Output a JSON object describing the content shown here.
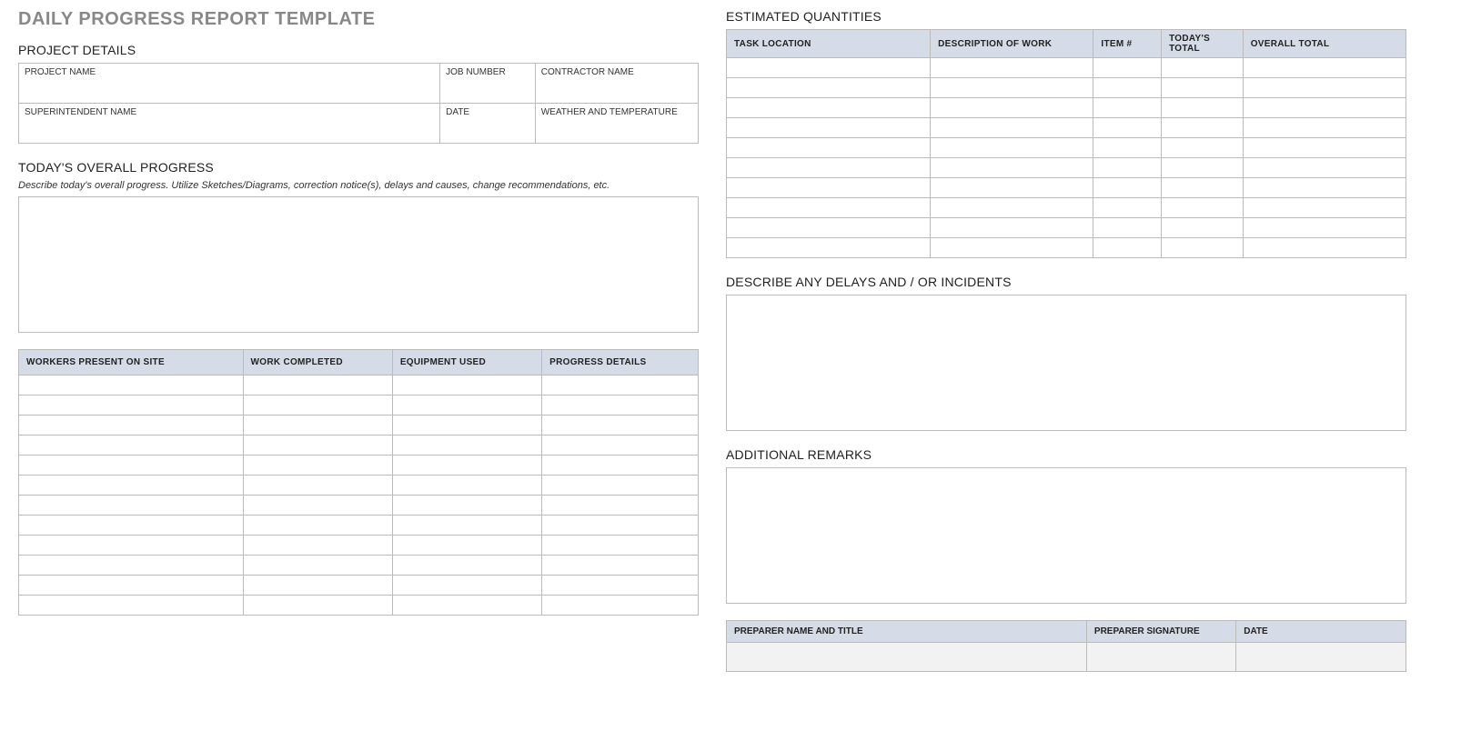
{
  "title": "DAILY PROGRESS REPORT TEMPLATE",
  "project_details": {
    "heading": "PROJECT DETAILS",
    "row1": {
      "project_name": {
        "label": "PROJECT NAME",
        "value": ""
      },
      "job_number": {
        "label": "JOB NUMBER",
        "value": ""
      },
      "contractor": {
        "label": "CONTRACTOR NAME",
        "value": ""
      }
    },
    "row2": {
      "superintendent": {
        "label": "SUPERINTENDENT NAME",
        "value": ""
      },
      "date": {
        "label": "DATE",
        "value": ""
      },
      "weather": {
        "label": "WEATHER AND TEMPERATURE",
        "value": ""
      }
    }
  },
  "overall_progress": {
    "heading": "TODAY'S OVERALL PROGRESS",
    "hint": "Describe today's overall progress.  Utilize Sketches/Diagrams, correction notice(s), delays and causes, change recommendations, etc.",
    "value": ""
  },
  "work_table": {
    "headers": [
      "WORKERS PRESENT ON SITE",
      "WORK COMPLETED",
      "EQUIPMENT USED",
      "PROGRESS DETAILS"
    ],
    "rows": [
      [
        "",
        "",
        "",
        ""
      ],
      [
        "",
        "",
        "",
        ""
      ],
      [
        "",
        "",
        "",
        ""
      ],
      [
        "",
        "",
        "",
        ""
      ],
      [
        "",
        "",
        "",
        ""
      ],
      [
        "",
        "",
        "",
        ""
      ],
      [
        "",
        "",
        "",
        ""
      ],
      [
        "",
        "",
        "",
        ""
      ],
      [
        "",
        "",
        "",
        ""
      ],
      [
        "",
        "",
        "",
        ""
      ],
      [
        "",
        "",
        "",
        ""
      ],
      [
        "",
        "",
        "",
        ""
      ]
    ]
  },
  "estimated_quantities": {
    "heading": "ESTIMATED QUANTITIES",
    "headers": [
      "TASK LOCATION",
      "DESCRIPTION OF WORK",
      "ITEM #",
      "TODAY'S TOTAL",
      "OVERALL TOTAL"
    ],
    "rows": [
      [
        "",
        "",
        "",
        "",
        ""
      ],
      [
        "",
        "",
        "",
        "",
        ""
      ],
      [
        "",
        "",
        "",
        "",
        ""
      ],
      [
        "",
        "",
        "",
        "",
        ""
      ],
      [
        "",
        "",
        "",
        "",
        ""
      ],
      [
        "",
        "",
        "",
        "",
        ""
      ],
      [
        "",
        "",
        "",
        "",
        ""
      ],
      [
        "",
        "",
        "",
        "",
        ""
      ],
      [
        "",
        "",
        "",
        "",
        ""
      ],
      [
        "",
        "",
        "",
        "",
        ""
      ]
    ]
  },
  "delays": {
    "heading": "DESCRIBE ANY DELAYS AND / OR INCIDENTS",
    "value": ""
  },
  "remarks": {
    "heading": "ADDITIONAL REMARKS",
    "value": ""
  },
  "preparer": {
    "headers": [
      "PREPARER NAME AND TITLE",
      "PREPARER SIGNATURE",
      "DATE"
    ],
    "values": [
      "",
      "",
      ""
    ]
  }
}
